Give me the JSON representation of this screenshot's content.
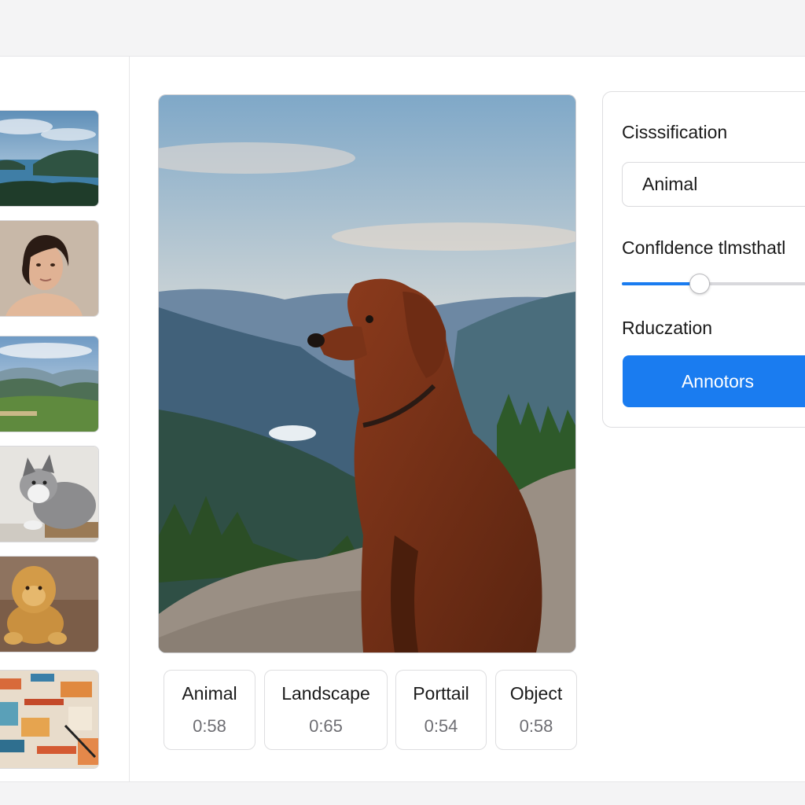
{
  "sidebar": {
    "thumbnails": [
      {
        "name": "lake-landscape"
      },
      {
        "name": "woman-portrait"
      },
      {
        "name": "valley-landscape"
      },
      {
        "name": "husky-plush"
      },
      {
        "name": "lion-plush"
      },
      {
        "name": "abstract-pattern"
      }
    ]
  },
  "viewer": {
    "subject": "dog-on-mountain"
  },
  "scores": [
    {
      "label": "Animal",
      "value": "0:58"
    },
    {
      "label": "Landscape",
      "value": "0:65"
    },
    {
      "label": "Porttail",
      "value": "0:54"
    },
    {
      "label": "Object",
      "value": "0:58"
    }
  ],
  "panel": {
    "classification_label": "Cisssification",
    "classification_value": "Animal",
    "confidence_label": "Confldence tlmsthatl",
    "confidence_value": 0.35,
    "reduction_label": "Rduczation",
    "annotate_button": "Annotors"
  },
  "colors": {
    "accent": "#1a7cf0",
    "background": "#f4f4f5"
  }
}
